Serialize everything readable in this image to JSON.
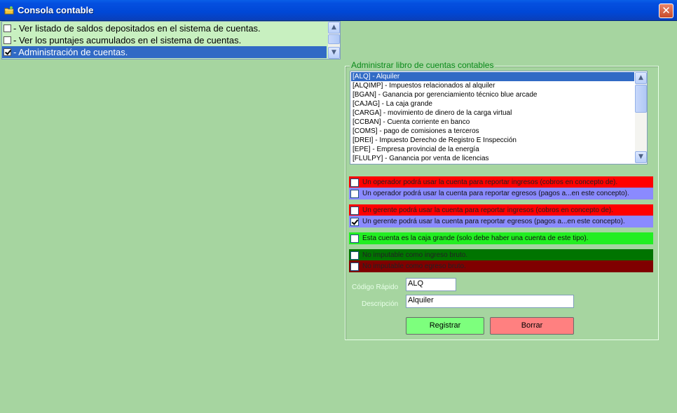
{
  "window": {
    "title": "Consola contable",
    "close_symbol": "✕",
    "icon": "folder-icon",
    "colors": {
      "background": "#a6d5a0",
      "titlebar": "#0047d6",
      "close": "#d4583a"
    }
  },
  "menu": {
    "items": [
      {
        "label": "- Ver listado de saldos depositados en el sistema de cuentas.",
        "checked": false,
        "selected": false
      },
      {
        "label": "- Ver los puntajes acumulados en el sistema de cuentas.",
        "checked": false,
        "selected": false
      },
      {
        "label": "- Administración de cuentas.",
        "checked": true,
        "selected": true
      }
    ],
    "colors": {
      "background": "#c8f0c0",
      "selection": "#316ac5"
    }
  },
  "accounts_group": {
    "title": "Administrar libro de cuentas contables",
    "items": [
      "[ALQ] - Alquiler",
      "[ALQIMP] - Impuestos relacionados al alquiler",
      "[BGAN] - Ganancia por gerenciamiento técnico blue arcade",
      "[CAJAG] - La caja grande",
      "[CARGA] - movimiento de dinero de la carga virtual",
      "[CCBAN] - Cuenta corriente en banco",
      "[COMS] - pago de comisiones a terceros",
      "[DREI] - Impuesto Derecho de Registro E Inspección",
      "[EPE] - Empresa provincial de la energía",
      "[FLULPY] - Ganancia por venta de licencias"
    ],
    "selected_index": 0
  },
  "options": [
    {
      "label": "Un operador podrá usar la cuenta para reportar ingresos (cobros en concepto de).",
      "checked": false,
      "color": "#ff0000"
    },
    {
      "label": "Un operador podrá usar la cuenta para reportar egresos (pagos a...en este concepto).",
      "checked": false,
      "color": "#8a8aff"
    },
    {
      "label": "Un gerente podrá usar la cuenta para reportar ingresos (cobros en concepto de).",
      "checked": false,
      "color": "#ff0000"
    },
    {
      "label": "Un gerente podrá usar la cuenta para reportar egresos (pagos a...en este concepto).",
      "checked": true,
      "color": "#8a8aff"
    },
    {
      "label": "Esta cuenta es la caja grande (solo debe haber una cuenta de este tipo).",
      "checked": false,
      "color": "#22ee22"
    },
    {
      "label": "No imputable como ingreso bruto.",
      "checked": false,
      "color": "#007400"
    },
    {
      "label": "No imputable como egreso bruto.",
      "checked": false,
      "color": "#800000"
    }
  ],
  "form": {
    "code_label": "Código Rápido",
    "code_value": "ALQ",
    "description_label": "Descripción",
    "description_value": "Alquiler"
  },
  "buttons": {
    "register": {
      "label": "Registrar",
      "color": "#7dff7d"
    },
    "delete": {
      "label": "Borrar",
      "color": "#ff8080"
    }
  }
}
